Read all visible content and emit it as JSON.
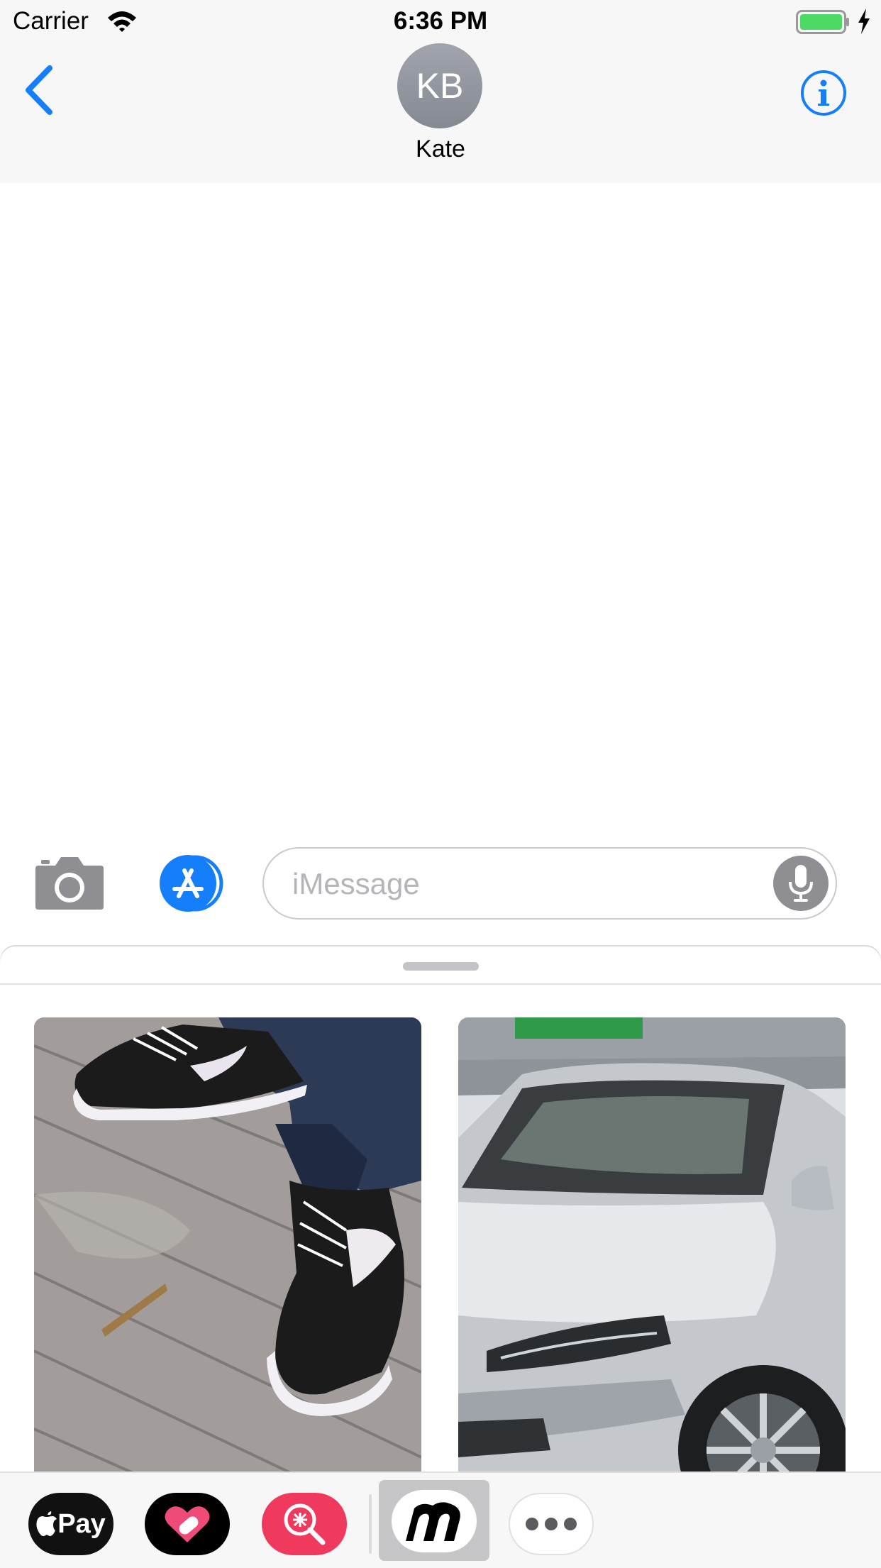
{
  "status_bar": {
    "carrier": "Carrier",
    "time": "6:36 PM"
  },
  "header": {
    "back_icon": "chevron-left-icon",
    "avatar_initials": "KB",
    "contact_name": "Kate",
    "info_icon": "info-icon",
    "accent_color": "#147efb"
  },
  "compose": {
    "camera_icon": "camera-icon",
    "app_store_icon": "app-store-icon",
    "placeholder": "iMessage",
    "mic_icon": "microphone-icon"
  },
  "drawer": {
    "images": [
      {
        "subject": "sneakers-photo"
      },
      {
        "subject": "car-photo"
      }
    ]
  },
  "app_strip": {
    "apple_pay_label": "Pay",
    "apps": [
      "apple-pay-icon",
      "heart-app-icon",
      "search-app-icon",
      "m-app-icon",
      "more-icon"
    ]
  }
}
